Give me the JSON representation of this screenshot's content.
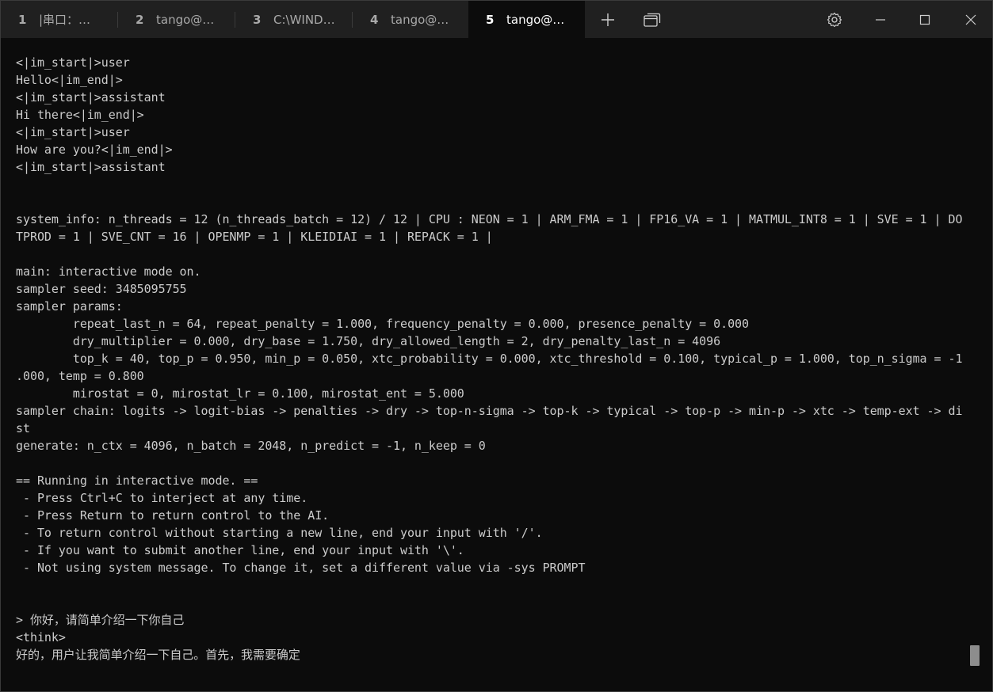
{
  "tabs": [
    {
      "number": "1",
      "title": "|串口：…"
    },
    {
      "number": "2",
      "title": "tango@…"
    },
    {
      "number": "3",
      "title": "C:\\WIND…"
    },
    {
      "number": "4",
      "title": "tango@…"
    },
    {
      "number": "5",
      "title": "tango@…",
      "active": true
    }
  ],
  "icons": {
    "new_tab": "plus-icon",
    "tab_overview": "windows-stack-icon",
    "settings": "gear-icon",
    "minimize": "minimize-icon",
    "maximize": "maximize-icon",
    "close": "close-icon"
  },
  "colors": {
    "background": "#0c0c0c",
    "titlebar": "#202020",
    "text": "#cccccc"
  },
  "terminal": {
    "lines": [
      "<|im_start|>user",
      "Hello<|im_end|>",
      "<|im_start|>assistant",
      "Hi there<|im_end|>",
      "<|im_start|>user",
      "How are you?<|im_end|>",
      "<|im_start|>assistant",
      "",
      "",
      "system_info: n_threads = 12 (n_threads_batch = 12) / 12 | CPU : NEON = 1 | ARM_FMA = 1 | FP16_VA = 1 | MATMUL_INT8 = 1 | SVE = 1 | DO",
      "TPROD = 1 | SVE_CNT = 16 | OPENMP = 1 | KLEIDIAI = 1 | REPACK = 1 |",
      "",
      "main: interactive mode on.",
      "sampler seed: 3485095755",
      "sampler params:",
      "        repeat_last_n = 64, repeat_penalty = 1.000, frequency_penalty = 0.000, presence_penalty = 0.000",
      "        dry_multiplier = 0.000, dry_base = 1.750, dry_allowed_length = 2, dry_penalty_last_n = 4096",
      "        top_k = 40, top_p = 0.950, min_p = 0.050, xtc_probability = 0.000, xtc_threshold = 0.100, typical_p = 1.000, top_n_sigma = -1",
      ".000, temp = 0.800",
      "        mirostat = 0, mirostat_lr = 0.100, mirostat_ent = 5.000",
      "sampler chain: logits -> logit-bias -> penalties -> dry -> top-n-sigma -> top-k -> typical -> top-p -> min-p -> xtc -> temp-ext -> di",
      "st",
      "generate: n_ctx = 4096, n_batch = 2048, n_predict = -1, n_keep = 0",
      "",
      "== Running in interactive mode. ==",
      " - Press Ctrl+C to interject at any time.",
      " - Press Return to return control to the AI.",
      " - To return control without starting a new line, end your input with '/'.",
      " - If you want to submit another line, end your input with '\\'.",
      " - Not using system message. To change it, set a different value via -sys PROMPT",
      "",
      "",
      "> 你好，请简单介绍一下你自己",
      "<think>",
      "好的，用户让我简单介绍一下自己。首先，我需要确定"
    ]
  }
}
